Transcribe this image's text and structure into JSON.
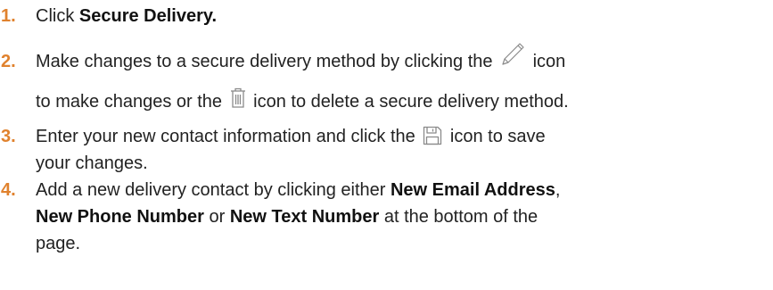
{
  "steps": [
    {
      "number": "1.",
      "pre": "Click ",
      "bold": "Secure Delivery."
    },
    {
      "number": "2.",
      "line1_pre": "Make changes to a secure delivery method by clicking the ",
      "line1_post": " icon",
      "line2_pre": "to make changes or the ",
      "line2_post": " icon to delete a secure delivery method."
    },
    {
      "number": "3.",
      "line1_pre": "Enter your new contact information and click the ",
      "line1_post": " icon to save",
      "line2": "your changes."
    },
    {
      "number": "4.",
      "line1_pre": "Add a new delivery contact by clicking either ",
      "line1_bold": "New Email Address",
      "line1_post": ",",
      "line2_bold1": "New Phone Number",
      "line2_mid": " or ",
      "line2_bold2": "New Text Number",
      "line2_post": " at the bottom of the",
      "line3": "page."
    }
  ],
  "icons": {
    "edit": "pencil-icon",
    "delete": "trash-icon",
    "save": "floppy-disk-icon"
  },
  "colors": {
    "number": "#e0822e",
    "text": "#222222",
    "icon": "#8a8a8a"
  }
}
